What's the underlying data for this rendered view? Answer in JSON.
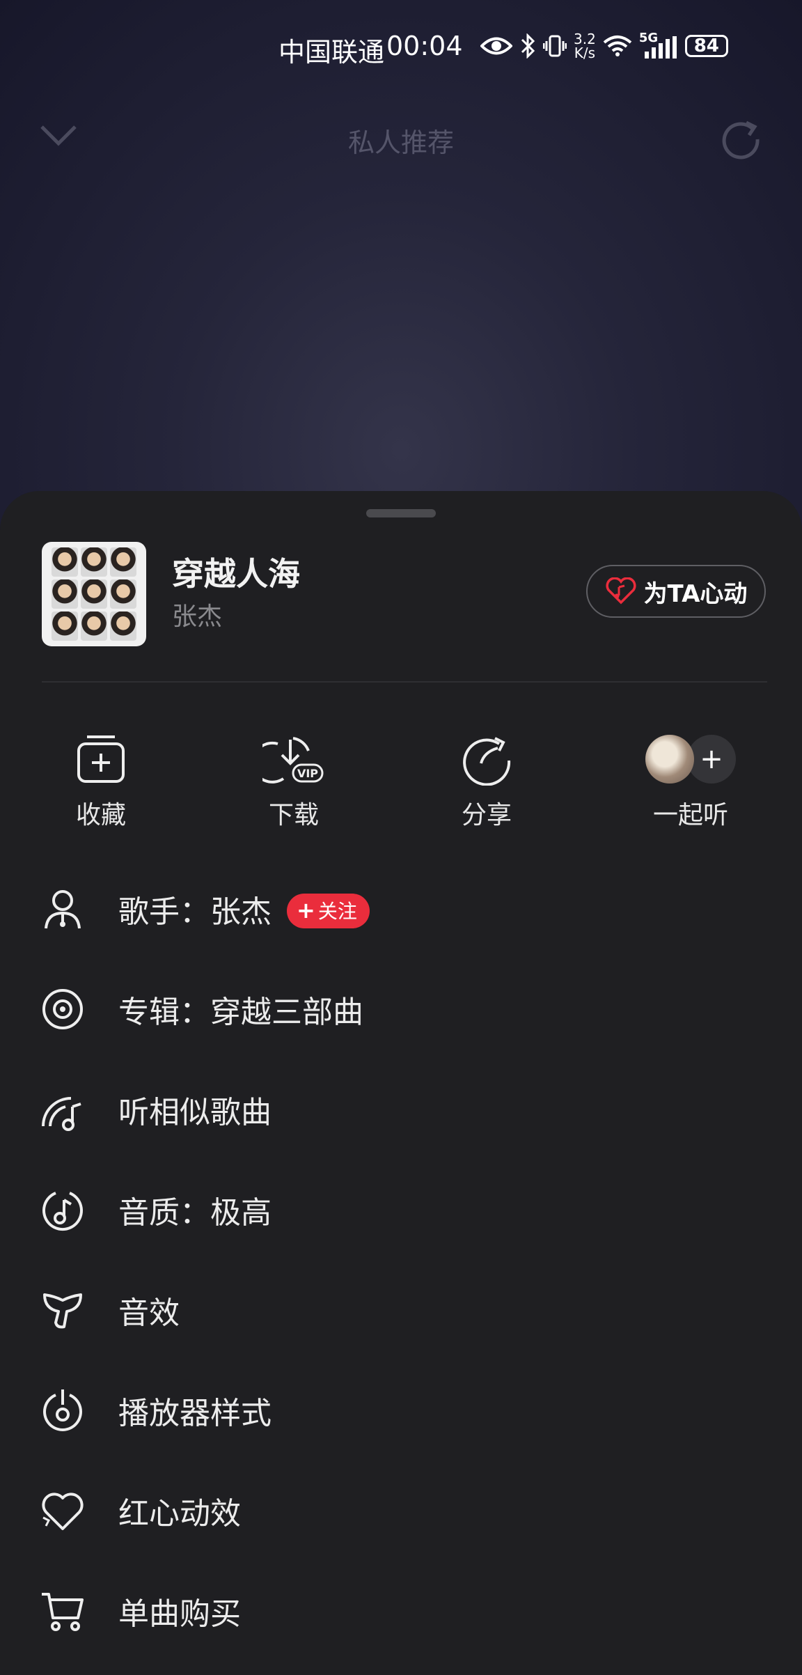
{
  "status_bar": {
    "carrier": "中国联通",
    "time": "00:04",
    "net_speed_value": "3.2",
    "net_speed_unit": "K/s",
    "network": "5G",
    "battery": "84"
  },
  "header": {
    "title": "私人推荐"
  },
  "song": {
    "title": "穿越人海",
    "artist": "张杰",
    "heart_button": "为TA心动"
  },
  "actions": [
    {
      "label": "收藏",
      "icon": "add-to-collection-icon"
    },
    {
      "label": "下载",
      "icon": "download-vip-icon",
      "badge": "VIP"
    },
    {
      "label": "分享",
      "icon": "share-icon"
    },
    {
      "label": "一起听",
      "icon": "listen-together-icon"
    }
  ],
  "menu": {
    "singer": {
      "prefix": "歌手：",
      "value": "张杰",
      "follow": "关注"
    },
    "album": {
      "prefix": "专辑：",
      "value": "穿越三部曲"
    },
    "similar": "听相似歌曲",
    "quality": {
      "prefix": "音质：",
      "value": "极高"
    },
    "effects": "音效",
    "player_style": "播放器样式",
    "heart_effect": "红心动效",
    "buy": "单曲购买"
  },
  "colors": {
    "accent_red": "#ea2d3c",
    "sheet_bg": "#1f1f22",
    "text_primary": "#ececec",
    "text_secondary": "#8a8a8e"
  }
}
